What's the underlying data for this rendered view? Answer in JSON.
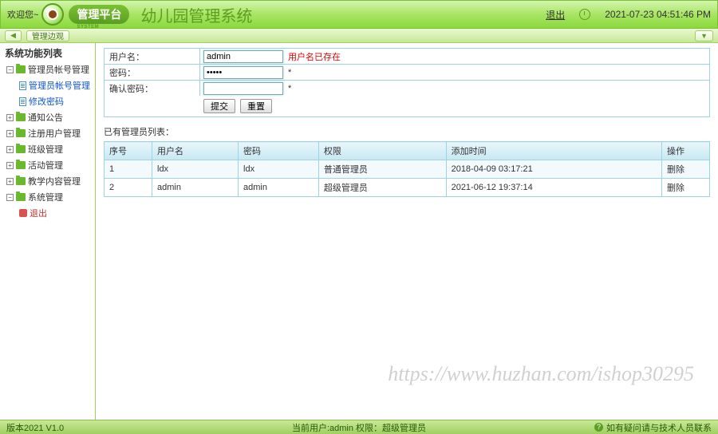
{
  "header": {
    "welcome": "欢迎您~",
    "platform_badge": "管理平台",
    "platform_sub": "PLATFORM SYSTEM",
    "app_title": "幼儿园管理系统",
    "logout": "退出",
    "datetime": "2021-07-23 04:51:46 PM"
  },
  "subheader": {
    "overview_btn": "管理边观"
  },
  "sidebar": {
    "title": "系统功能列表",
    "items": [
      {
        "label": "管理员帐号管理",
        "type": "folder",
        "expanded": true
      },
      {
        "label": "管理员帐号管理",
        "type": "doc",
        "sub": true,
        "link": true
      },
      {
        "label": "修改密码",
        "type": "doc",
        "sub": true,
        "link": true
      },
      {
        "label": "通知公告",
        "type": "folder"
      },
      {
        "label": "注册用户管理",
        "type": "folder"
      },
      {
        "label": "班级管理",
        "type": "folder"
      },
      {
        "label": "活动管理",
        "type": "folder"
      },
      {
        "label": "教学内容管理",
        "type": "folder"
      },
      {
        "label": "系统管理",
        "type": "folder",
        "expanded": true
      },
      {
        "label": "退出",
        "type": "exit",
        "sub": true,
        "red": true
      }
    ]
  },
  "form": {
    "username_label": "用户名：",
    "username_value": "admin",
    "username_error": "用户名已存在",
    "password_label": "密码：",
    "password_value": "•••••",
    "confirm_label": "确认密码：",
    "confirm_value": "",
    "required_mark": "*",
    "submit": "提交",
    "reset": "重置"
  },
  "table": {
    "caption": "已有管理员列表：",
    "headers": [
      "序号",
      "用户名",
      "密码",
      "权限",
      "添加时间",
      "操作"
    ],
    "rows": [
      {
        "cells": [
          "1",
          "ldx",
          "ldx",
          "普通管理员",
          "2018-04-09 03:17:21"
        ],
        "op": "删除"
      },
      {
        "cells": [
          "2",
          "admin",
          "admin",
          "超级管理员",
          "2021-06-12 19:37:14"
        ],
        "op": "删除"
      }
    ]
  },
  "footer": {
    "version": "版本2021 V1.0",
    "current_user": "当前用户:admin 权限：超级管理员",
    "support": "如有疑问请与技术人员联系"
  },
  "watermark": "https://www.huzhan.com/ishop30295"
}
